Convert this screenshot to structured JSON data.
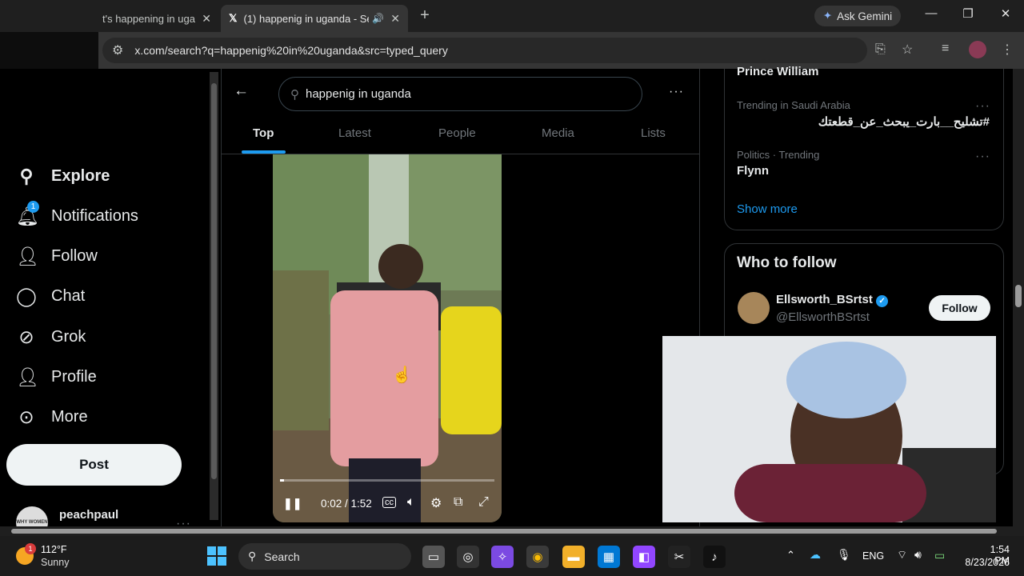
{
  "browser": {
    "tab1_title": "t's happening in ugan",
    "tab2_title": "(1) happenig in uganda - Se",
    "ask_gemini": "Ask Gemini",
    "url": "x.com/search?q=happenig%20in%20uganda&src=typed_query"
  },
  "sidebar": {
    "items": [
      {
        "label": "Explore",
        "icon": "search-icon"
      },
      {
        "label": "Notifications",
        "icon": "bell-icon",
        "badge": "1"
      },
      {
        "label": "Follow",
        "icon": "person-plus-icon"
      },
      {
        "label": "Chat",
        "icon": "chat-icon"
      },
      {
        "label": "Grok",
        "icon": "grok-icon"
      },
      {
        "label": "Profile",
        "icon": "person-icon"
      },
      {
        "label": "More",
        "icon": "more-circle-icon"
      }
    ],
    "post_label": "Post",
    "account_name": "peachpaul",
    "avatar_text": "WHY WOMEN"
  },
  "search": {
    "query": "happenig in uganda",
    "tabs": [
      "Top",
      "Latest",
      "People",
      "Media",
      "Lists"
    ],
    "active_tab": "Top"
  },
  "video": {
    "time": "0:02 / 1:52",
    "progress": 0.02
  },
  "trends": {
    "items": [
      {
        "context": "",
        "title": "Prince William"
      },
      {
        "context": "Trending in Saudi Arabia",
        "title": "#تشليح__بارت_يبحث_عن_قطعتك"
      },
      {
        "context": "Politics · Trending",
        "title": "Flynn"
      }
    ],
    "show_more": "Show more"
  },
  "who_to_follow": {
    "heading": "Who to follow",
    "name": "Ellsworth_BSrtst",
    "handle": "@EllsworthBSrtst",
    "follow_label": "Follow"
  },
  "taskbar": {
    "weather_temp": "112°F",
    "weather_desc": "Sunny",
    "weather_badge": "1",
    "search_label": "Search",
    "lang": "ENG",
    "time": "1:54 PM",
    "date": "8/23/2026"
  }
}
